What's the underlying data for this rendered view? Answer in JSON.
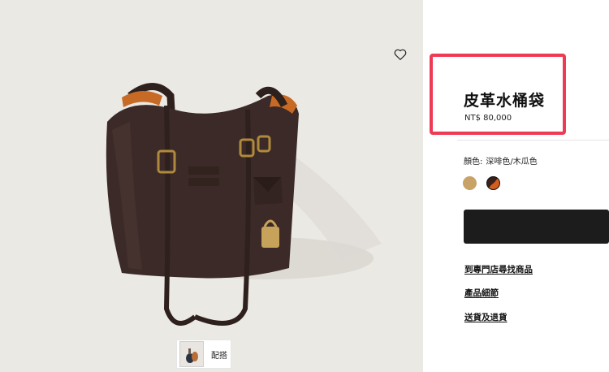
{
  "product": {
    "title": "皮革水桶袋",
    "price": "NT$ 80,000",
    "color_label": "顏色:",
    "color_value": "深啡色/木瓜色",
    "swatches": [
      {
        "name": "caramel",
        "color": "#c8a267"
      },
      {
        "name": "brown-papaya",
        "colors": [
          "#3a2019",
          "#d25d1f"
        ],
        "selected": true
      }
    ],
    "cta_label": ""
  },
  "gallery": {
    "thumbnail_label": "配搭",
    "wishlist_icon": "heart-outline-icon"
  },
  "links": {
    "store": "到專門店尋找商品",
    "details": "產品細節",
    "shipping": "送貨及退貨"
  },
  "colors": {
    "highlight": "#ef3a55",
    "cta_bg": "#1d1c1c",
    "image_bg": "#ebe9e4"
  }
}
